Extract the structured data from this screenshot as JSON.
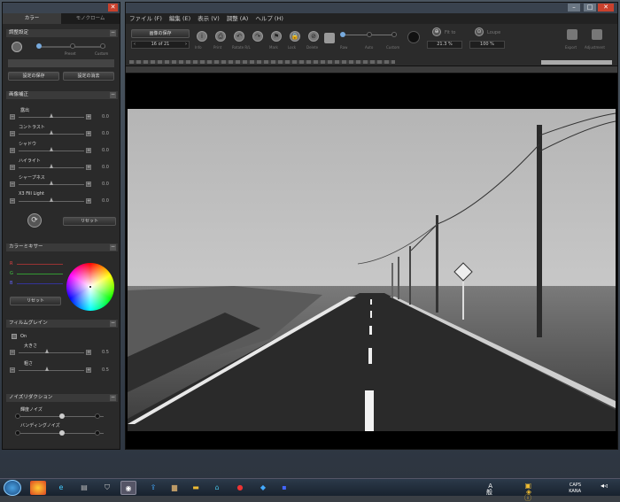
{
  "left_panel": {
    "tabs": [
      "カラー",
      "モノクローム"
    ],
    "presets": {
      "title": "調整設定",
      "slider_labels": [
        "Preset",
        "Custom"
      ],
      "save_label": "設定の保存",
      "delete_label": "設定の消去"
    },
    "correction": {
      "title": "画像補正",
      "sliders": [
        {
          "label": "露出",
          "value": "0.0"
        },
        {
          "label": "コントラスト",
          "value": "0.0"
        },
        {
          "label": "シャドウ",
          "value": "0.0"
        },
        {
          "label": "ハイライト",
          "value": "0.0"
        },
        {
          "label": "シャープネス",
          "value": "0.0"
        },
        {
          "label": "X3 Fill Light",
          "value": "0.0"
        }
      ],
      "reset_label": "リセット"
    },
    "color_mixer": {
      "title": "カラーミキサー",
      "channels": [
        "R",
        "G",
        "B"
      ],
      "reset_label": "リセット"
    },
    "film_grain": {
      "title": "フィルムグレイン",
      "checkbox_label": "On",
      "sliders": [
        {
          "label": "大きさ",
          "value": "0.5"
        },
        {
          "label": "粗さ",
          "value": "0.5"
        }
      ]
    },
    "noise": {
      "title": "ノイズリダクション",
      "rows": [
        {
          "label": "輝度ノイズ",
          "ends": [
            "Low",
            "Mid",
            "Hi"
          ]
        },
        {
          "label": "バンディングノイズ",
          "ends": [
            "Low",
            "Mid",
            "Hi"
          ]
        }
      ]
    }
  },
  "main": {
    "menu": [
      "ファイル (F)",
      "編集 (E)",
      "表示 (V)",
      "調整 (A)",
      "ヘルプ (H)"
    ],
    "toolbar": {
      "save_label": "画像の保存",
      "counter": "16 of 21",
      "icons": [
        {
          "name": "info",
          "glyph": "i",
          "label": "Info"
        },
        {
          "name": "print",
          "glyph": "⎙",
          "label": "Print"
        },
        {
          "name": "rotate-left",
          "glyph": "↶",
          "label": "Rotate R/L"
        },
        {
          "name": "rotate-right",
          "glyph": "↷",
          "label": ""
        },
        {
          "name": "mark",
          "glyph": "⚑",
          "label": "Mark"
        },
        {
          "name": "lock",
          "glyph": "🔒",
          "label": "Lock"
        },
        {
          "name": "delete",
          "glyph": "⊘",
          "label": "Delete"
        }
      ],
      "mode_labels": [
        "Raw",
        "Auto",
        "Custom"
      ],
      "fit_label": "Fit to",
      "zoom": "21.3 %",
      "loupe_label": "Loupe",
      "loupe_zoom": "100 %",
      "right_icons": [
        "Export",
        "Adjustment"
      ]
    }
  },
  "taskbar": {
    "tray_lang": "A 般",
    "time": "CAPS",
    "date": "KANA"
  }
}
